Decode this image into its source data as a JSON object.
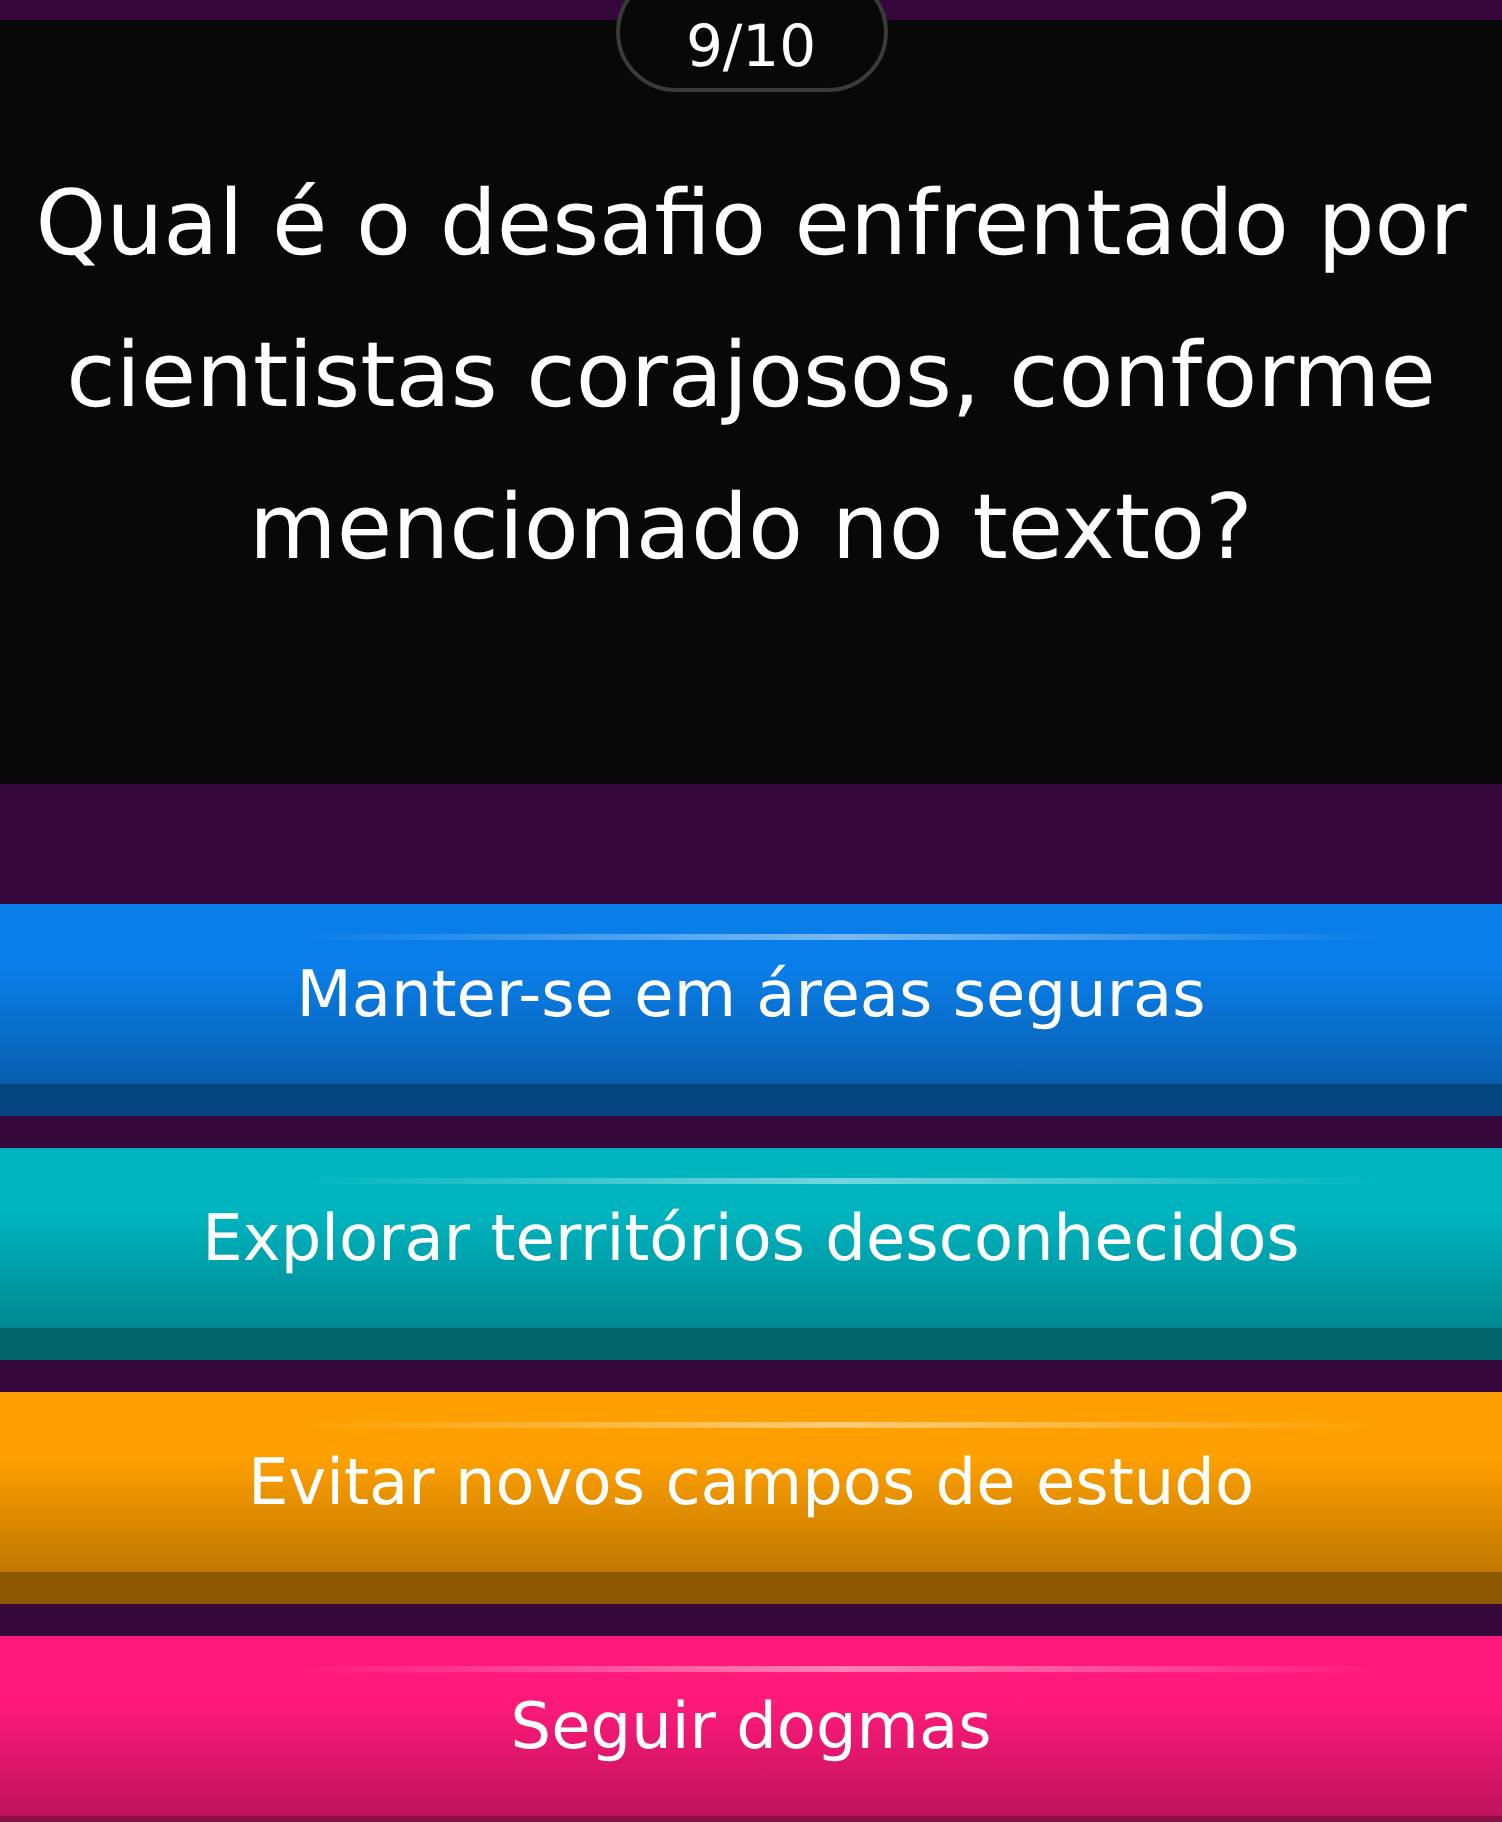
{
  "counter": "9/10",
  "question": "Qual é o desafio enfrentado por cientistas corajosos, conforme mencionado no texto?",
  "answers": [
    {
      "label": "Manter-se em áreas seguras",
      "color": "#0a7ee8"
    },
    {
      "label": "Explorar territórios desconhecidos",
      "color": "#00b5c0"
    },
    {
      "label": "Evitar novos campos de estudo",
      "color": "#ffa000"
    },
    {
      "label": "Seguir dogmas",
      "color": "#ff1a7a"
    }
  ]
}
